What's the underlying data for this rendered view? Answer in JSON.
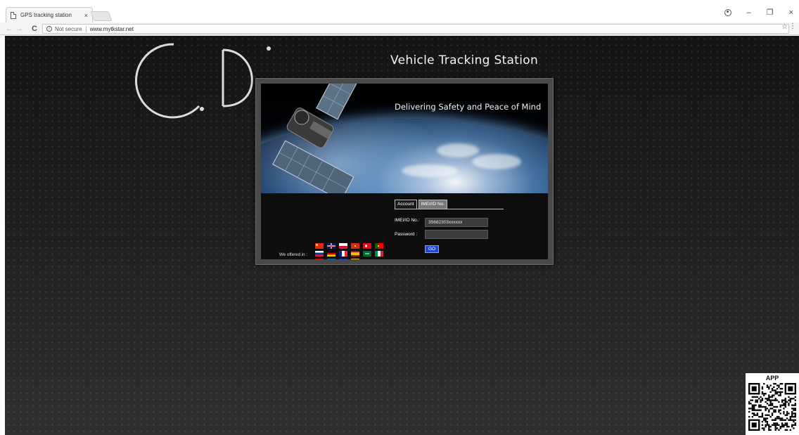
{
  "browser": {
    "tab_title": "GPS tracking station",
    "tab_close": "×",
    "security_label": "Not secure",
    "url": "www.mytkstar.net",
    "controls": {
      "minimize": "–",
      "restore": "❐",
      "close": "×"
    }
  },
  "page": {
    "title": "Vehicle Tracking Station",
    "subtitle": "Delivering Safety and Peace of Mind",
    "tabs": [
      {
        "label": "Account",
        "active": true
      },
      {
        "label": "IMEI/ID No.",
        "active": false
      }
    ],
    "form": {
      "imei_label": "IMEI/ID No.:",
      "imei_value": "35682303xxxxxx",
      "password_label": "Password :",
      "password_value": "",
      "submit_label": "GO"
    },
    "languages_label": "We offered in :",
    "flags": [
      "china-flag",
      "uk-flag",
      "poland-flag",
      "vietnam-flag",
      "turkey-flag",
      "portugal-flag",
      "russia-flag",
      "germany-flag",
      "france-flag",
      "spain-flag",
      "saudi-flag",
      "italy-flag",
      "macedonia-flag",
      "greece-flag",
      "cambodia-flag",
      "montenegro-flag"
    ],
    "qr": {
      "label": "APP"
    }
  },
  "colors": {
    "background": "#242424",
    "accent_button": "#2248d0",
    "text": "#f2f2f2"
  }
}
